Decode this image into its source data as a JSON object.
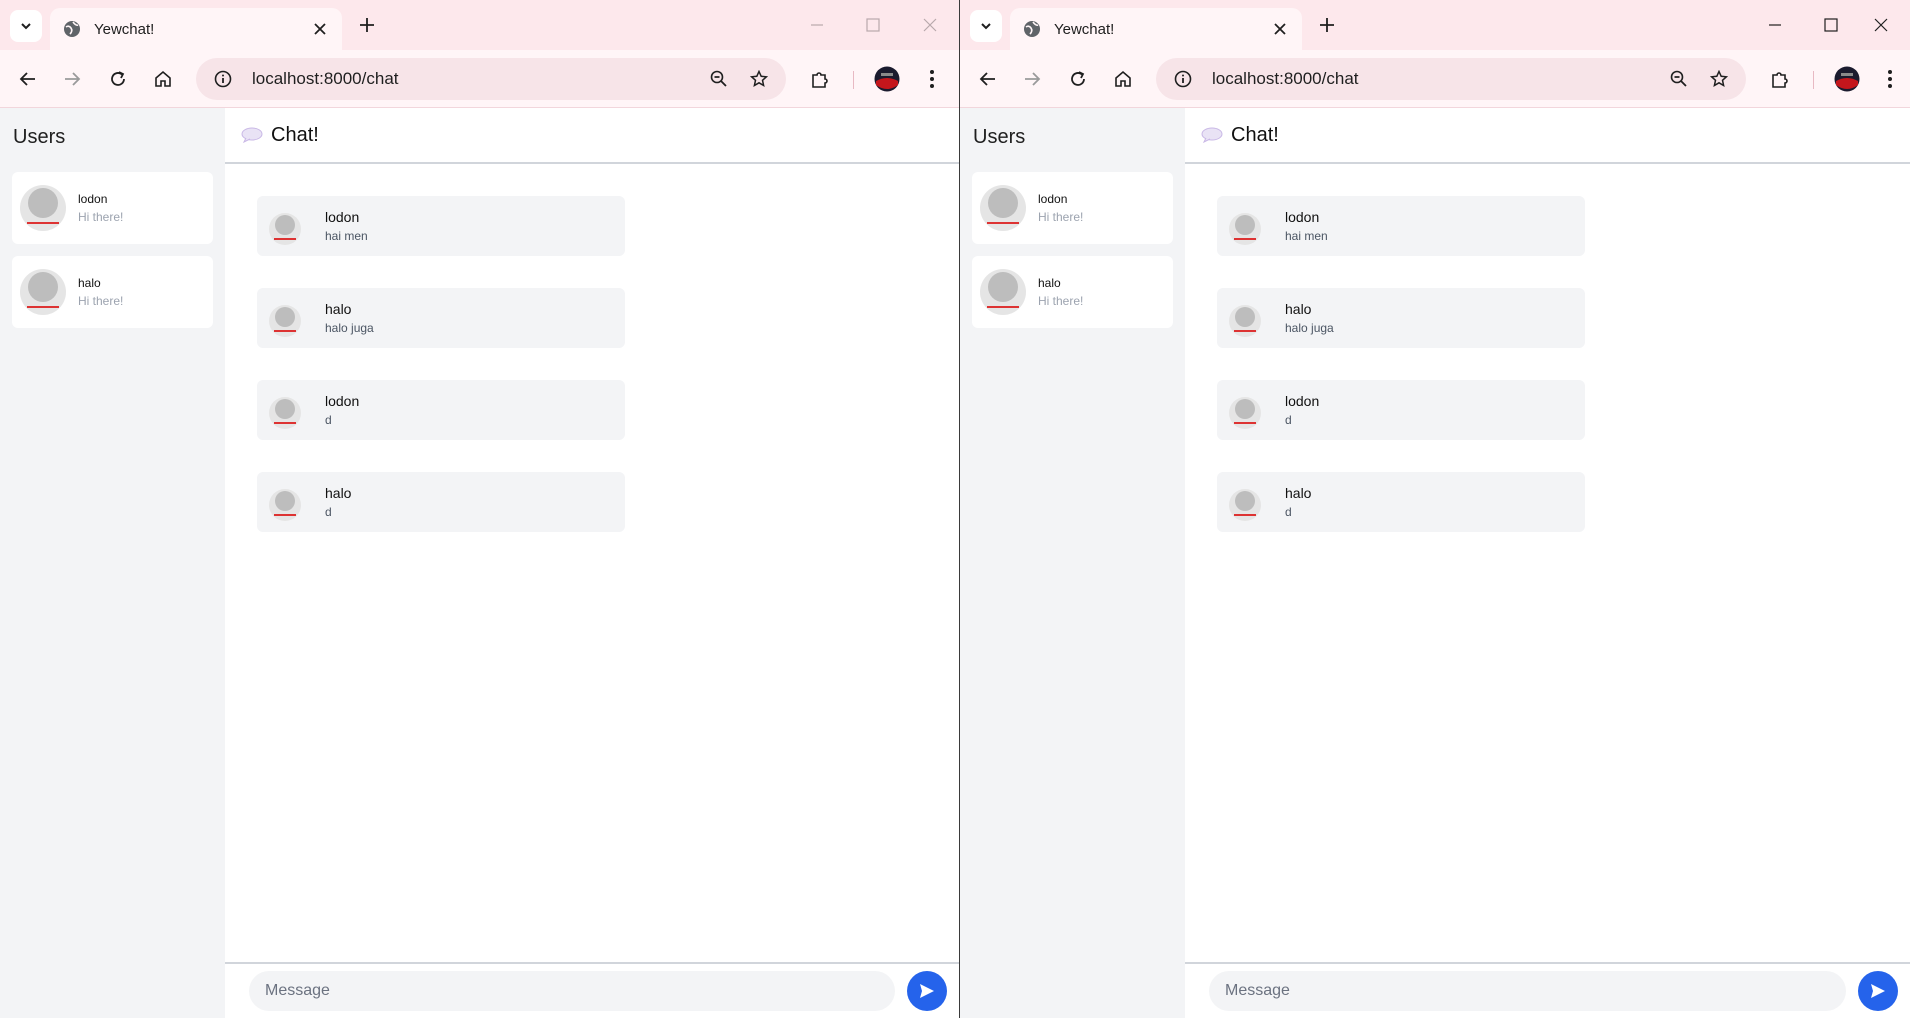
{
  "colors": {
    "tab_strip": "#fde8ec",
    "toolbar": "#fff5f7",
    "sidebar": "#f3f4f6",
    "send_button": "#2563eb"
  },
  "windows": [
    {
      "tab_title": "Yewchat!",
      "url": "localhost:8000/chat",
      "sidebar": {
        "heading": "Users",
        "users": [
          {
            "name": "lodon",
            "status": "Hi there!"
          },
          {
            "name": "halo",
            "status": "Hi there!"
          }
        ]
      },
      "chat": {
        "title": "Chat!",
        "messages": [
          {
            "from": "lodon",
            "text": "hai men"
          },
          {
            "from": "halo",
            "text": "halo juga"
          },
          {
            "from": "lodon",
            "text": "d"
          },
          {
            "from": "halo",
            "text": "d"
          }
        ],
        "input_placeholder": "Message"
      }
    },
    {
      "tab_title": "Yewchat!",
      "url": "localhost:8000/chat",
      "sidebar": {
        "heading": "Users",
        "users": [
          {
            "name": "lodon",
            "status": "Hi there!"
          },
          {
            "name": "halo",
            "status": "Hi there!"
          }
        ]
      },
      "chat": {
        "title": "Chat!",
        "messages": [
          {
            "from": "lodon",
            "text": "hai men"
          },
          {
            "from": "halo",
            "text": "halo juga"
          },
          {
            "from": "lodon",
            "text": "d"
          },
          {
            "from": "halo",
            "text": "d"
          }
        ],
        "input_placeholder": "Message"
      }
    }
  ]
}
